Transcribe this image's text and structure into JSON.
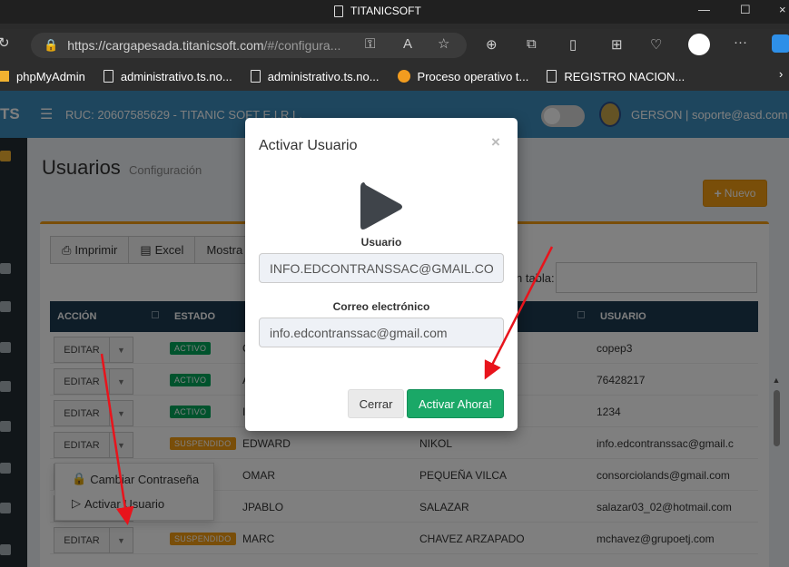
{
  "browser": {
    "window_title": "TITANICSOFT",
    "url_host": "https://cargapesada.titanicsoft.com",
    "url_path": "/#/configura...",
    "bookmarks": [
      {
        "label": "phpMyAdmin"
      },
      {
        "label": "administrativo.ts.no..."
      },
      {
        "label": "administrativo.ts.no..."
      },
      {
        "label": "Proceso operativo t..."
      },
      {
        "label": "REGISTRO NACION..."
      }
    ]
  },
  "header": {
    "logo": "TS",
    "ruc": "RUC: 20607585629 - TITANIC SOFT E.I.R.L.",
    "user": "GERSON | soporte@asd.com"
  },
  "page": {
    "title": "Usuarios",
    "subtitle": "Configuración",
    "new_button": "Nuevo"
  },
  "toolbar": {
    "print": "Imprimir",
    "excel": "Excel",
    "show": "Mostra",
    "search_label": "n tabla:"
  },
  "table": {
    "columns": {
      "action": "ACCIÓN",
      "status": "ESTADO",
      "user": "USUARIO"
    },
    "edit_label": "EDITAR",
    "rows": [
      {
        "status": "ACTIVO",
        "status_type": "ok",
        "nombre": "C",
        "apellido": "",
        "usuario": "copep3"
      },
      {
        "status": "ACTIVO",
        "status_type": "ok",
        "nombre": "A",
        "apellido": "",
        "usuario": "76428217"
      },
      {
        "status": "ACTIVO",
        "status_type": "ok",
        "nombre": "I",
        "apellido": "",
        "usuario": "1234"
      },
      {
        "status": "SUSPENDIDO",
        "status_type": "sus",
        "nombre": "EDWARD",
        "apellido": "NIKOL",
        "usuario": "info.edcontranssac@gmail.c"
      },
      {
        "status": "",
        "status_type": "",
        "nombre": "OMAR",
        "apellido": "PEQUEÑA VILCA",
        "usuario": "consorciolands@gmail.com"
      },
      {
        "status": "DIDO",
        "status_type": "sus",
        "nombre": "JPABLO",
        "apellido": "SALAZAR",
        "usuario": "salazar03_02@hotmail.com"
      },
      {
        "status": "SUSPENDIDO",
        "status_type": "sus",
        "nombre": "MARC",
        "apellido": "CHAVEZ ARZAPADO",
        "usuario": "mchavez@grupoetj.com"
      }
    ]
  },
  "dropdown": {
    "change_password": "Cambiar Contraseña",
    "activate_user": "Activar Usuario"
  },
  "modal": {
    "title": "Activar Usuario",
    "close": "×",
    "usuario_label": "Usuario",
    "usuario_value": "INFO.EDCONTRANSSAC@GMAIL.COM",
    "email_label": "Correo electrónico",
    "email_value": "info.edcontranssac@gmail.com",
    "cancel": "Cerrar",
    "confirm": "Activar Ahora!"
  },
  "colors": {
    "header_blue": "#3c8dbc",
    "table_header": "#1d3b50",
    "accent_orange": "#f39c12",
    "success_green": "#1aa867",
    "annotation_red": "#e8141c"
  }
}
